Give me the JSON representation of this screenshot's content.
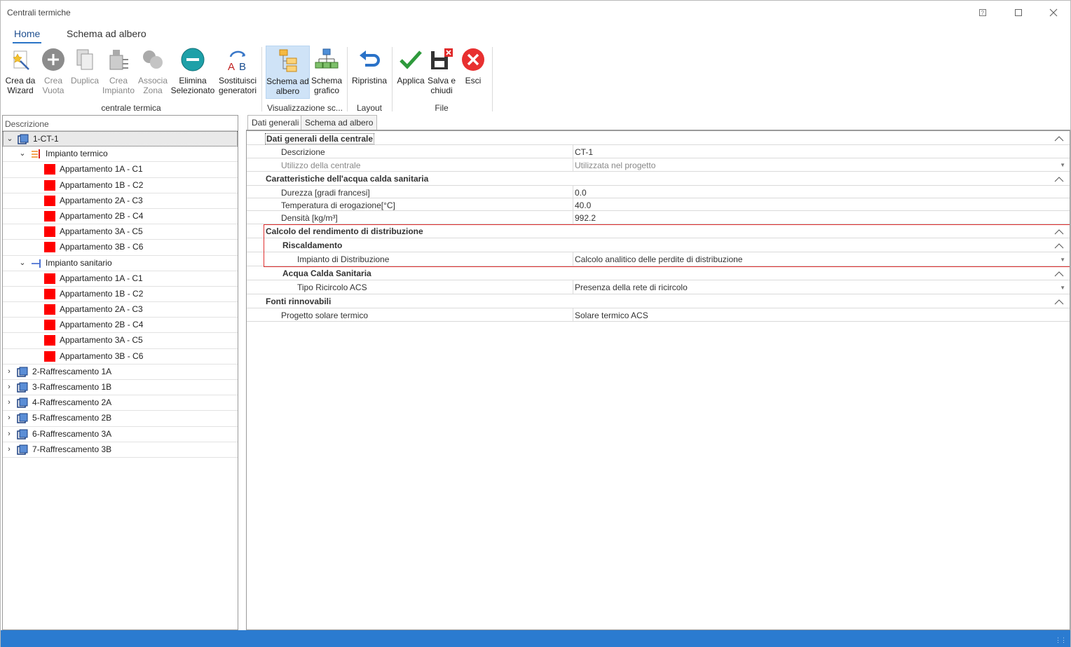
{
  "window": {
    "title": "Centrali termiche"
  },
  "ribbon_tabs": [
    "Home",
    "Schema ad albero"
  ],
  "ribbon": {
    "buttons": [
      {
        "label1": "Crea da",
        "label2": "Wizard",
        "icon": "wizard-icon"
      },
      {
        "label1": "Crea",
        "label2": "Vuota",
        "icon": "plus-circle-icon"
      },
      {
        "label1": "Duplica",
        "label2": "",
        "icon": "duplicate-icon"
      },
      {
        "label1": "Crea",
        "label2": "Impianto",
        "icon": "create-plant-icon"
      },
      {
        "label1": "Associa",
        "label2": "Zona",
        "icon": "associate-zone-icon"
      },
      {
        "label1": "Elimina",
        "label2": "Selezionato",
        "icon": "delete-circle-icon"
      },
      {
        "label1": "Sostituisci",
        "label2": "generatori",
        "icon": "replace-ab-icon"
      },
      {
        "label1": "Schema ad",
        "label2": "albero",
        "icon": "tree-schema-icon"
      },
      {
        "label1": "Schema",
        "label2": "grafico",
        "icon": "graphic-schema-icon"
      },
      {
        "label1": "Ripristina",
        "label2": "",
        "icon": "undo-icon"
      },
      {
        "label1": "Applica",
        "label2": "",
        "icon": "check-icon"
      },
      {
        "label1": "Salva e",
        "label2": "chiudi",
        "icon": "save-close-icon"
      },
      {
        "label1": "Esci",
        "label2": "",
        "icon": "exit-icon"
      }
    ],
    "groups": [
      "centrale termica",
      "Visualizzazione sc...",
      "Layout",
      "File"
    ]
  },
  "tree": {
    "header": "Descrizione",
    "root": "1-CT-1",
    "impianto_termico": "Impianto termico",
    "impianto_sanitario": "Impianto sanitario",
    "appartamenti": [
      "Appartamento 1A - C1",
      "Appartamento 1B - C2",
      "Appartamento 2A - C3",
      "Appartamento 2B - C4",
      "Appartamento 3A - C5",
      "Appartamento 3B - C6"
    ],
    "others": [
      "2-Raffrescamento 1A",
      "3-Raffrescamento 1B",
      "4-Raffrescamento 2A",
      "5-Raffrescamento 2B",
      "6-Raffrescamento 3A",
      "7-Raffrescamento 3B"
    ]
  },
  "panel_tabs": [
    "Dati generali",
    "Schema ad albero"
  ],
  "properties": {
    "cat1": "Dati generali della centrale",
    "descrizione_label": "Descrizione",
    "descrizione_value": "CT-1",
    "utilizzo_label": "Utilizzo della centrale",
    "utilizzo_value": "Utilizzata nel progetto",
    "cat2": "Caratteristiche dell'acqua calda sanitaria",
    "durezza_label": "Durezza [gradi francesi]",
    "durezza_value": "0.0",
    "temperatura_label": "Temperatura di erogazione[°C]",
    "temperatura_value": "40.0",
    "densita_label": "Densità [kg/m³]",
    "densita_value": "992.2",
    "cat3": "Calcolo del rendimento di distribuzione",
    "riscaldamento": "Riscaldamento",
    "impianto_label": "Impianto di  Distribuzione",
    "impianto_value": "Calcolo analitico delle perdite di distribuzione",
    "acs": "Acqua Calda Sanitaria",
    "ricircolo_label": "Tipo Ricircolo ACS",
    "ricircolo_value": "Presenza della rete di ricircolo",
    "cat4": "Fonti rinnovabili",
    "solare_label": "Progetto solare termico",
    "solare_value": "Solare termico ACS"
  }
}
